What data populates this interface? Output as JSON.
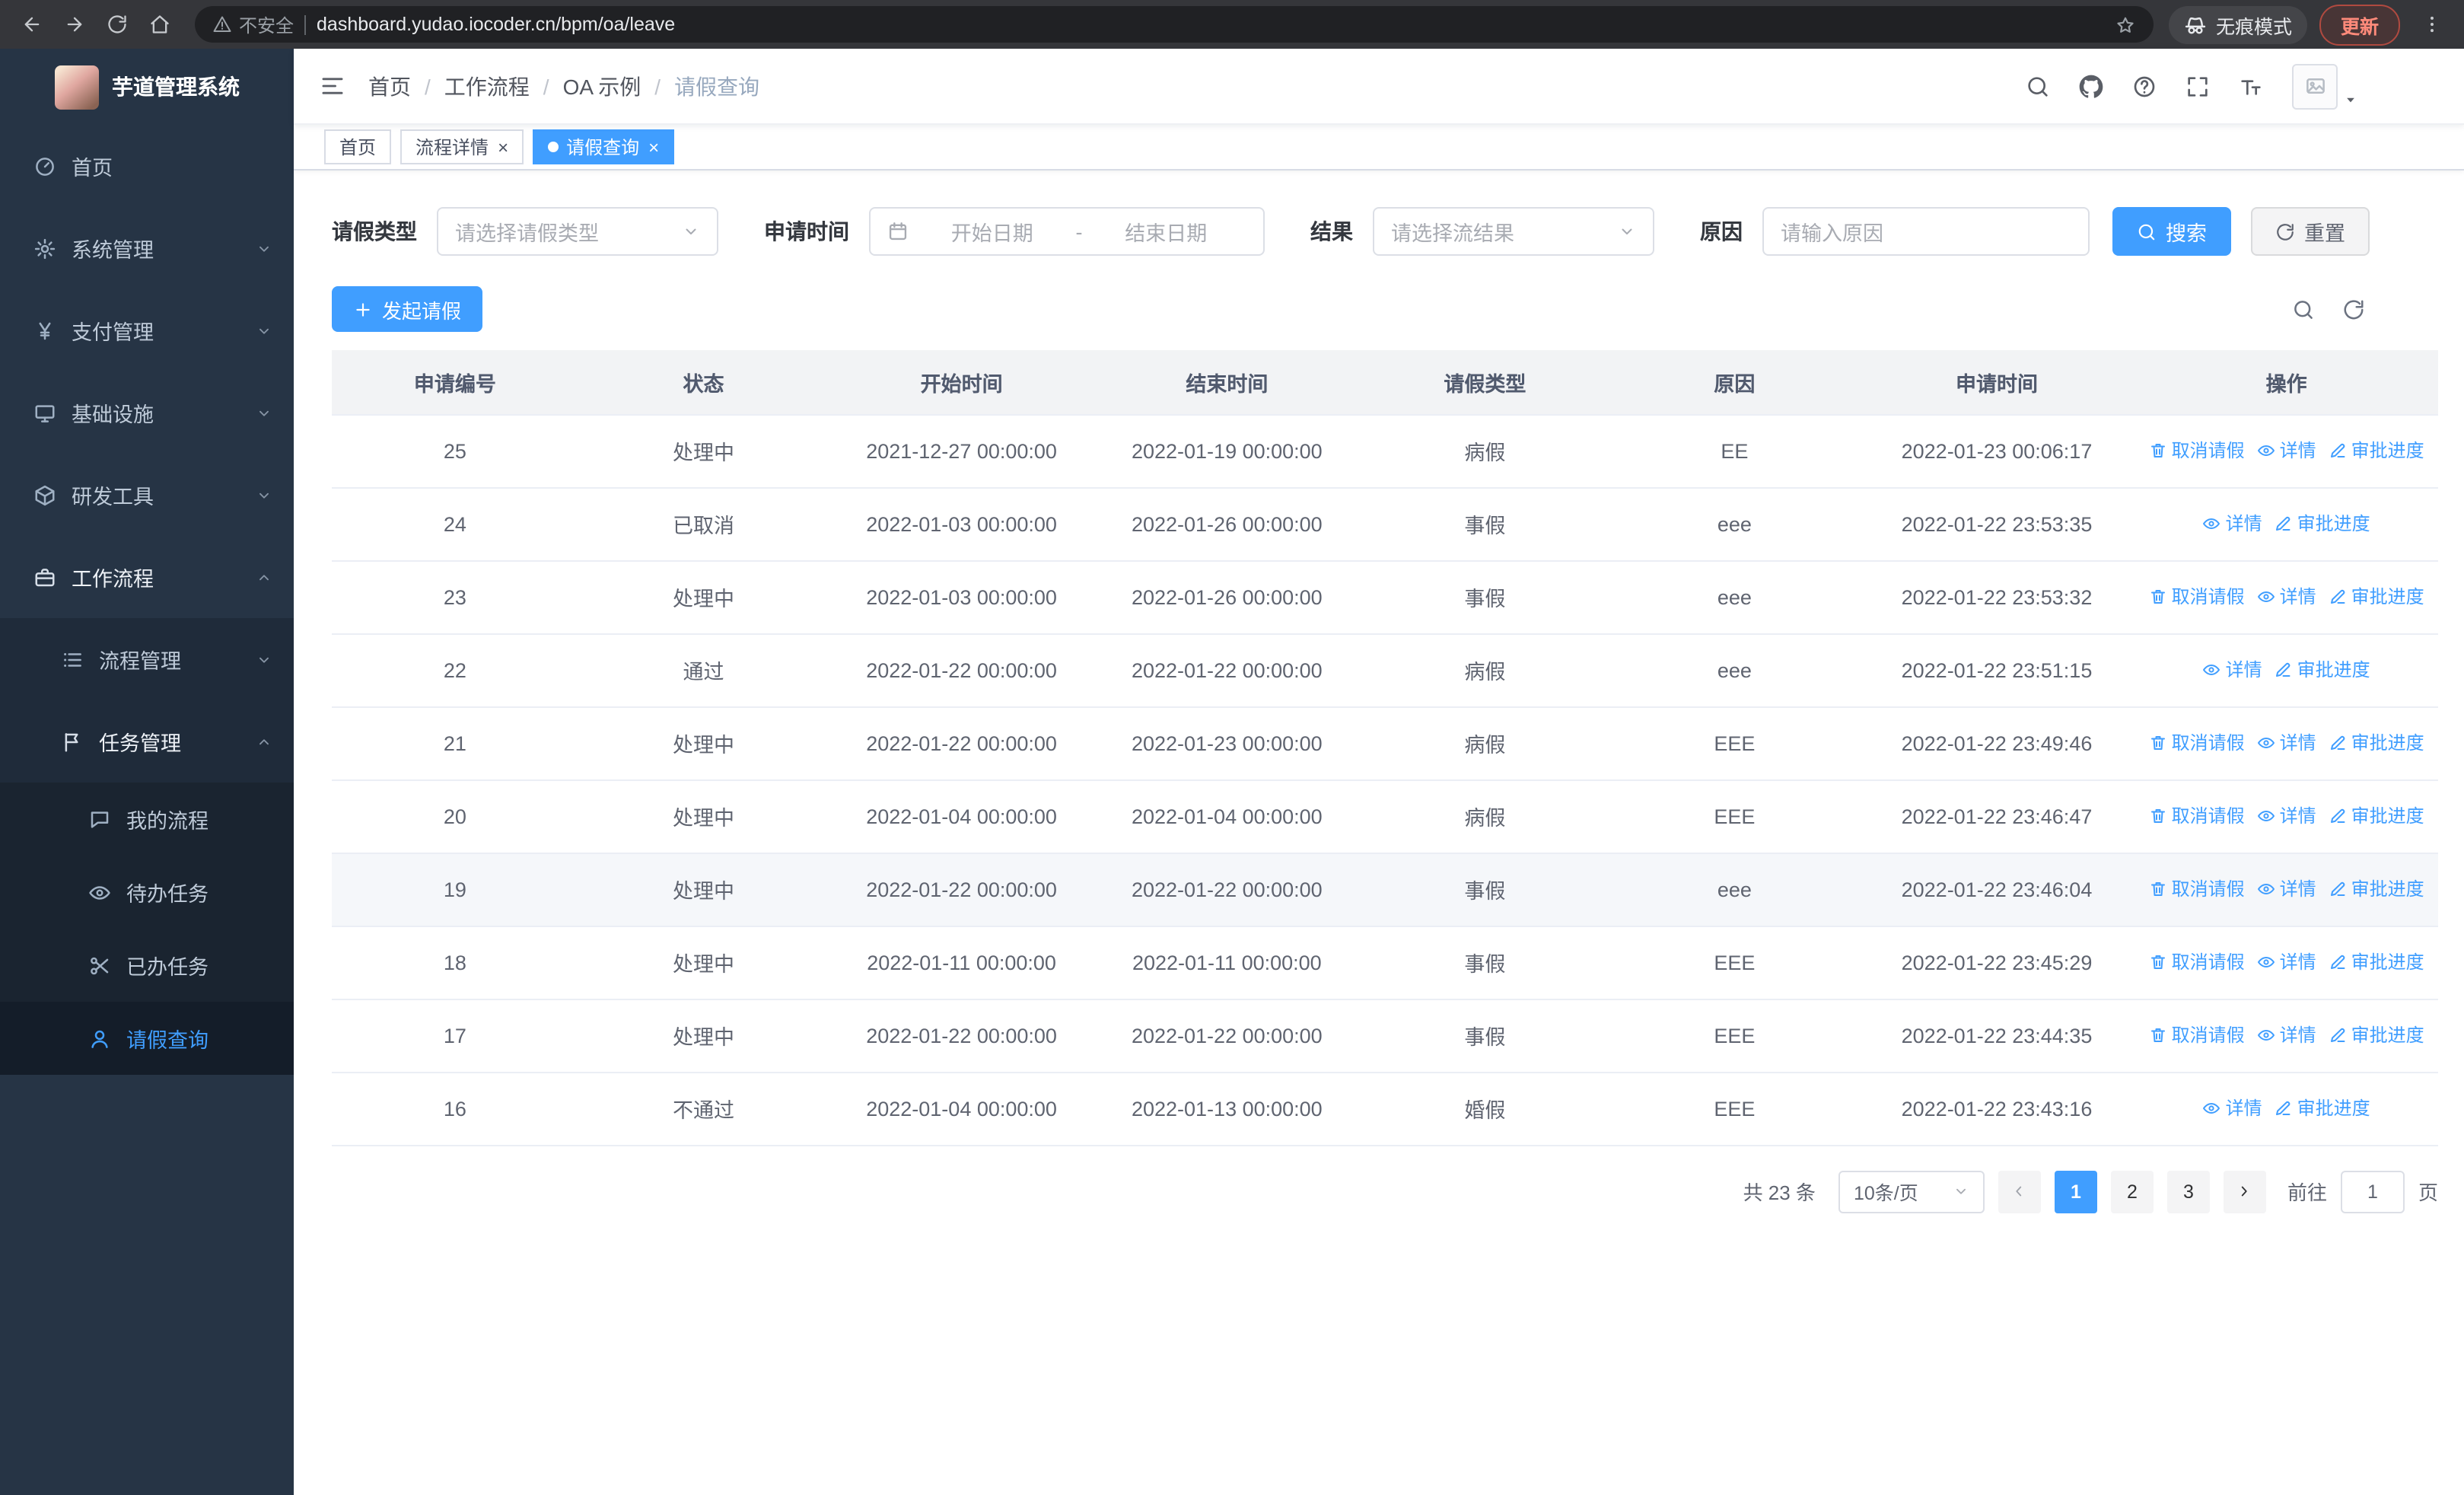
{
  "browser": {
    "security_label": "不安全",
    "url": "dashboard.yudao.iocoder.cn/bpm/oa/leave",
    "incognito_label": "无痕模式",
    "update_label": "更新"
  },
  "sidebar": {
    "logo_title": "芋道管理系统",
    "items": [
      {
        "label": "首页",
        "icon": "dashboard-icon",
        "level": 1
      },
      {
        "label": "系统管理",
        "icon": "gear-icon",
        "level": 1,
        "chevron": "down"
      },
      {
        "label": "支付管理",
        "icon": "yen-icon",
        "level": 1,
        "chevron": "down"
      },
      {
        "label": "基础设施",
        "icon": "monitor-icon",
        "level": 1,
        "chevron": "down"
      },
      {
        "label": "研发工具",
        "icon": "cube-icon",
        "level": 1,
        "chevron": "down"
      },
      {
        "label": "工作流程",
        "icon": "briefcase-icon",
        "level": 1,
        "chevron": "up",
        "trail": true
      },
      {
        "label": "流程管理",
        "icon": "list-icon",
        "level": 2,
        "chevron": "down"
      },
      {
        "label": "任务管理",
        "icon": "flag-icon",
        "level": 2,
        "chevron": "up",
        "trail": true
      },
      {
        "label": "我的流程",
        "icon": "chat-icon",
        "level": 3
      },
      {
        "label": "待办任务",
        "icon": "eye-icon",
        "level": 3
      },
      {
        "label": "已办任务",
        "icon": "scissors-icon",
        "level": 3
      },
      {
        "label": "请假查询",
        "icon": "user-icon",
        "level": 3,
        "active": true
      }
    ]
  },
  "header": {
    "breadcrumb": [
      "首页",
      "工作流程",
      "OA 示例",
      "请假查询"
    ],
    "breadcrumb_separator": "/"
  },
  "tabs": [
    {
      "label": "首页",
      "closable": false
    },
    {
      "label": "流程详情",
      "closable": true
    },
    {
      "label": "请假查询",
      "closable": true,
      "active": true
    }
  ],
  "filters": {
    "leave_type_label": "请假类型",
    "leave_type_placeholder": "请选择请假类型",
    "apply_time_label": "申请时间",
    "date_start_placeholder": "开始日期",
    "date_separator": "-",
    "date_end_placeholder": "结束日期",
    "result_label": "结果",
    "result_placeholder": "请选择流结果",
    "reason_label": "原因",
    "reason_placeholder": "请输入原因",
    "search_button": "搜索",
    "reset_button": "重置"
  },
  "toolbar": {
    "create_button": "发起请假"
  },
  "table": {
    "columns": [
      "申请编号",
      "状态",
      "开始时间",
      "结束时间",
      "请假类型",
      "原因",
      "申请时间",
      "操作"
    ],
    "action_defs": {
      "cancel": {
        "label": "取消请假",
        "icon": "delete-icon",
        "name": "cancel-leave-link"
      },
      "detail": {
        "label": "详情",
        "icon": "view-icon",
        "name": "detail-link"
      },
      "progress": {
        "label": "审批进度",
        "icon": "edit-icon",
        "name": "approval-progress-link"
      }
    },
    "rows": [
      {
        "id": "25",
        "status": "处理中",
        "start_time": "2021-12-27 00:00:00",
        "end_time": "2022-01-19 00:00:00",
        "leave_type": "病假",
        "reason": "EE",
        "apply_time": "2022-01-23 00:06:17",
        "actions": [
          "cancel",
          "detail",
          "progress"
        ]
      },
      {
        "id": "24",
        "status": "已取消",
        "start_time": "2022-01-03 00:00:00",
        "end_time": "2022-01-26 00:00:00",
        "leave_type": "事假",
        "reason": "eee",
        "apply_time": "2022-01-22 23:53:35",
        "actions": [
          "detail",
          "progress"
        ]
      },
      {
        "id": "23",
        "status": "处理中",
        "start_time": "2022-01-03 00:00:00",
        "end_time": "2022-01-26 00:00:00",
        "leave_type": "事假",
        "reason": "eee",
        "apply_time": "2022-01-22 23:53:32",
        "actions": [
          "cancel",
          "detail",
          "progress"
        ]
      },
      {
        "id": "22",
        "status": "通过",
        "start_time": "2022-01-22 00:00:00",
        "end_time": "2022-01-22 00:00:00",
        "leave_type": "病假",
        "reason": "eee",
        "apply_time": "2022-01-22 23:51:15",
        "actions": [
          "detail",
          "progress"
        ]
      },
      {
        "id": "21",
        "status": "处理中",
        "start_time": "2022-01-22 00:00:00",
        "end_time": "2022-01-23 00:00:00",
        "leave_type": "病假",
        "reason": "EEE",
        "apply_time": "2022-01-22 23:49:46",
        "actions": [
          "cancel",
          "detail",
          "progress"
        ]
      },
      {
        "id": "20",
        "status": "处理中",
        "start_time": "2022-01-04 00:00:00",
        "end_time": "2022-01-04 00:00:00",
        "leave_type": "病假",
        "reason": "EEE",
        "apply_time": "2022-01-22 23:46:47",
        "actions": [
          "cancel",
          "detail",
          "progress"
        ]
      },
      {
        "id": "19",
        "status": "处理中",
        "start_time": "2022-01-22 00:00:00",
        "end_time": "2022-01-22 00:00:00",
        "leave_type": "事假",
        "reason": "eee",
        "apply_time": "2022-01-22 23:46:04",
        "actions": [
          "cancel",
          "detail",
          "progress"
        ],
        "highlighted": true
      },
      {
        "id": "18",
        "status": "处理中",
        "start_time": "2022-01-11 00:00:00",
        "end_time": "2022-01-11 00:00:00",
        "leave_type": "事假",
        "reason": "EEE",
        "apply_time": "2022-01-22 23:45:29",
        "actions": [
          "cancel",
          "detail",
          "progress"
        ]
      },
      {
        "id": "17",
        "status": "处理中",
        "start_time": "2022-01-22 00:00:00",
        "end_time": "2022-01-22 00:00:00",
        "leave_type": "事假",
        "reason": "EEE",
        "apply_time": "2022-01-22 23:44:35",
        "actions": [
          "cancel",
          "detail",
          "progress"
        ]
      },
      {
        "id": "16",
        "status": "不通过",
        "start_time": "2022-01-04 00:00:00",
        "end_time": "2022-01-13 00:00:00",
        "leave_type": "婚假",
        "reason": "EEE",
        "apply_time": "2022-01-22 23:43:16",
        "actions": [
          "detail",
          "progress"
        ]
      }
    ]
  },
  "pagination": {
    "total": "共 23 条",
    "page_size": "10条/页",
    "pages": [
      {
        "label": "1",
        "active": true
      },
      {
        "label": "2"
      },
      {
        "label": "3"
      }
    ],
    "goto_label": "前往",
    "goto_value": "1",
    "goto_suffix": "页"
  }
}
